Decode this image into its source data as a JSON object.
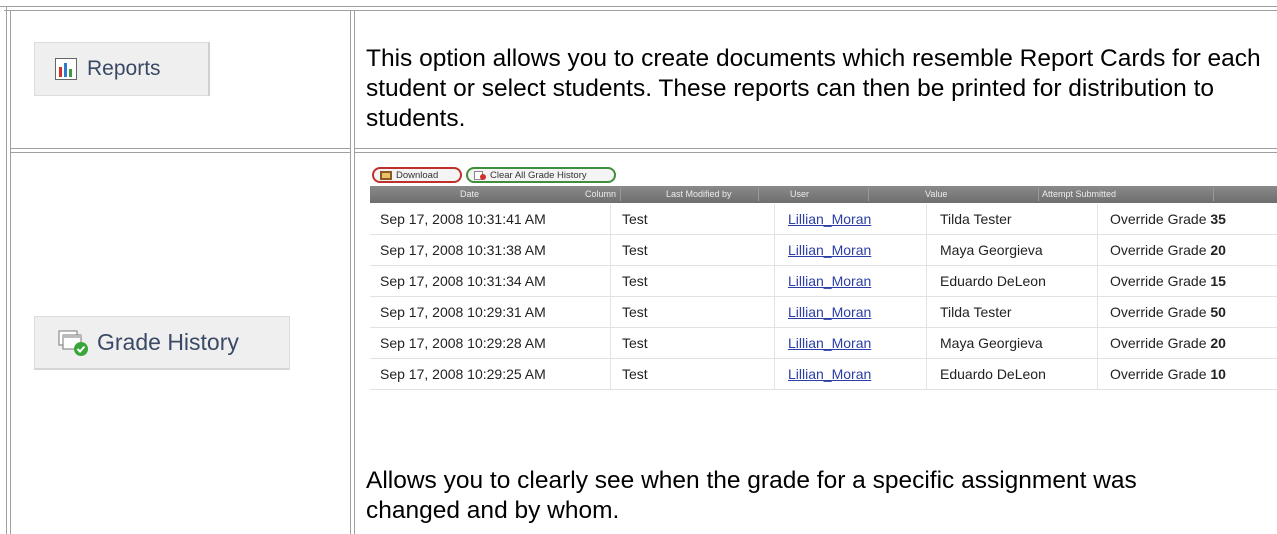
{
  "reports": {
    "button_label": "Reports",
    "description": "This option allows you to create documents which resemble Report Cards for each student or select students. These reports can then be printed for distribution to students."
  },
  "grade_history": {
    "button_label": "Grade History",
    "toolbar": {
      "download_label": "Download",
      "clear_label": "Clear All Grade History"
    },
    "headers": [
      "Date",
      "Column",
      "Last Modified by",
      "User",
      "Value",
      "Attempt Submitted"
    ],
    "rows": [
      {
        "date": "Sep 17, 2008 10:31:41 AM",
        "column": "Test",
        "modified_by": "Lillian_Moran",
        "user": "Tilda Tester",
        "value_prefix": "Override Grade",
        "value": "35"
      },
      {
        "date": "Sep 17, 2008 10:31:38 AM",
        "column": "Test",
        "modified_by": "Lillian_Moran",
        "user": "Maya Georgieva",
        "value_prefix": "Override Grade",
        "value": "20"
      },
      {
        "date": "Sep 17, 2008 10:31:34 AM",
        "column": "Test",
        "modified_by": "Lillian_Moran",
        "user": "Eduardo DeLeon",
        "value_prefix": "Override Grade",
        "value": "15"
      },
      {
        "date": "Sep 17, 2008 10:29:31 AM",
        "column": "Test",
        "modified_by": "Lillian_Moran",
        "user": "Tilda Tester",
        "value_prefix": "Override Grade",
        "value": "50"
      },
      {
        "date": "Sep 17, 2008 10:29:28 AM",
        "column": "Test",
        "modified_by": "Lillian_Moran",
        "user": "Maya Georgieva",
        "value_prefix": "Override Grade",
        "value": "20"
      },
      {
        "date": "Sep 17, 2008 10:29:25 AM",
        "column": "Test",
        "modified_by": "Lillian_Moran",
        "user": "Eduardo DeLeon",
        "value_prefix": "Override Grade",
        "value": "10"
      }
    ],
    "description": "Allows you to clearly see when the grade for a specific assignment was changed and by whom."
  }
}
